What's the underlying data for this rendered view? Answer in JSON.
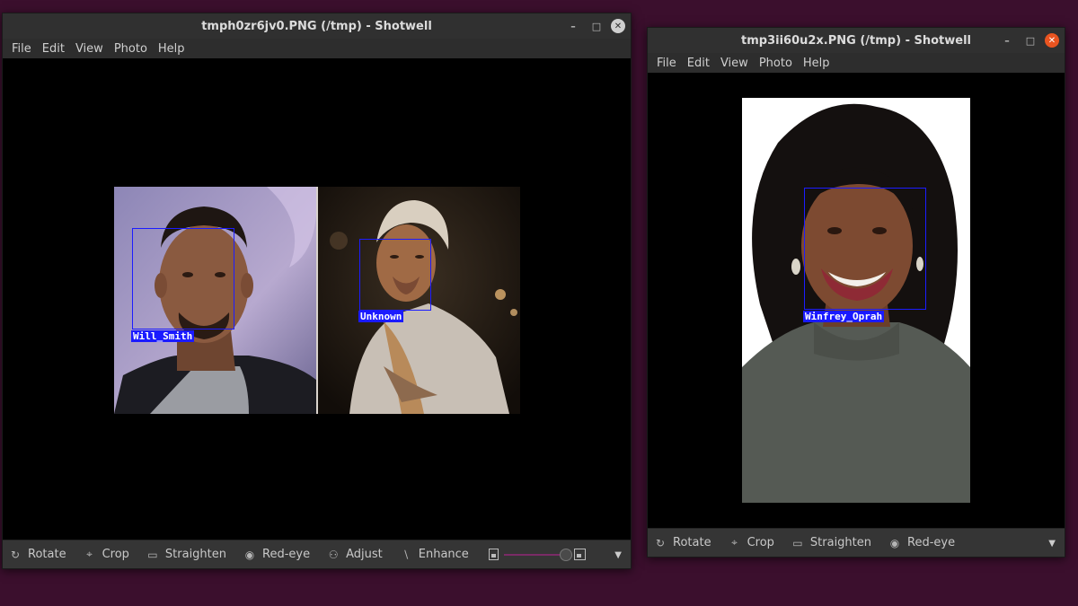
{
  "windows": [
    {
      "title": "tmph0zr6jv0.PNG (/tmp) - Shotwell",
      "menu": [
        "File",
        "Edit",
        "View",
        "Photo",
        "Help"
      ],
      "faces": [
        {
          "label": "Will_Smith"
        },
        {
          "label": "Unknown"
        }
      ],
      "toolbar": {
        "rotate": "Rotate",
        "crop": "Crop",
        "straighten": "Straighten",
        "redeye": "Red-eye",
        "adjust": "Adjust",
        "enhance": "Enhance"
      },
      "zoom_level": 1.0
    },
    {
      "title": "tmp3ii60u2x.PNG (/tmp) - Shotwell",
      "menu": [
        "File",
        "Edit",
        "View",
        "Photo",
        "Help"
      ],
      "faces": [
        {
          "label": "Winfrey_Oprah"
        }
      ],
      "toolbar": {
        "rotate": "Rotate",
        "crop": "Crop",
        "straighten": "Straighten",
        "redeye": "Red-eye"
      }
    }
  ],
  "colors": {
    "desktop": "#3b0f2d",
    "titlebar": "#303030",
    "face_box": "#1c1cff",
    "close_active": "#e95420"
  },
  "icons": [
    "minimize-icon",
    "maximize-icon",
    "close-icon",
    "rotate-icon",
    "crop-icon",
    "straighten-icon",
    "eye-icon",
    "adjust-icon",
    "enhance-icon",
    "zoom-out-icon",
    "zoom-in-icon",
    "chevron-down-icon"
  ]
}
